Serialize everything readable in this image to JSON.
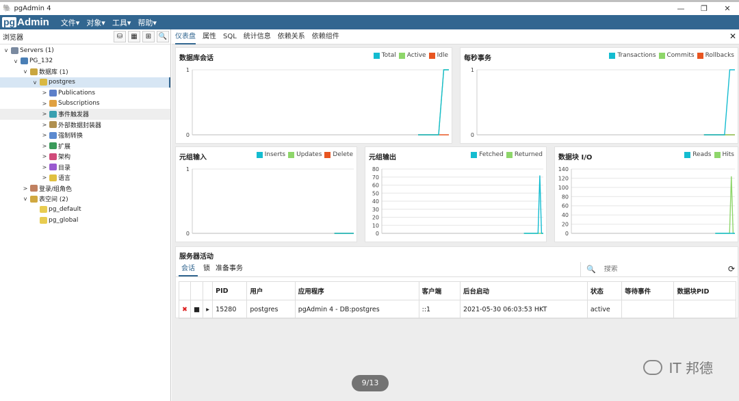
{
  "window": {
    "title": "pgAdmin 4",
    "controls": [
      "—",
      "❐",
      "✕"
    ]
  },
  "menubar": {
    "logo_pg": "pg",
    "logo_admin": "Admin",
    "items": [
      "文件▾",
      "对象▾",
      "工具▾",
      "帮助▾"
    ]
  },
  "browser": {
    "title": "浏览器",
    "tools": [
      "⛁",
      "▦",
      "⊞",
      "🔍"
    ],
    "tree": [
      {
        "label": "Servers (1)",
        "toggle": "v",
        "icon": "servers-icon",
        "color": "#7a8aa0",
        "level": 0
      },
      {
        "label": "PG_132",
        "toggle": "v",
        "icon": "elephant-icon",
        "color": "#4a7fb5",
        "level": 1
      },
      {
        "label": "数据库 (1)",
        "toggle": "v",
        "icon": "databases-icon",
        "color": "#c9a640",
        "level": 2
      },
      {
        "label": "postgres",
        "toggle": "v",
        "icon": "database-icon",
        "color": "#d9b842",
        "level": 3,
        "state": "sel"
      },
      {
        "label": "Publications",
        "toggle": ">",
        "icon": "publication-icon",
        "color": "#5c7fc9",
        "level": 4
      },
      {
        "label": "Subscriptions",
        "toggle": ">",
        "icon": "subscription-icon",
        "color": "#e0a040",
        "level": 4
      },
      {
        "label": "事件触发器",
        "toggle": ">",
        "icon": "event-trigger-icon",
        "color": "#3aa0b0",
        "level": 4,
        "state": "hov"
      },
      {
        "label": "外部数据封装器",
        "toggle": ">",
        "icon": "fdw-icon",
        "color": "#b09050",
        "level": 4
      },
      {
        "label": "强制转换",
        "toggle": ">",
        "icon": "cast-icon",
        "color": "#5c8ad0",
        "level": 4
      },
      {
        "label": "扩展",
        "toggle": ">",
        "icon": "extension-icon",
        "color": "#3a9a5a",
        "level": 4
      },
      {
        "label": "架构",
        "toggle": ">",
        "icon": "schema-icon",
        "color": "#d04a7a",
        "level": 4
      },
      {
        "label": "目录",
        "toggle": ">",
        "icon": "catalog-icon",
        "color": "#9a5ad0",
        "level": 4
      },
      {
        "label": "语言",
        "toggle": ">",
        "icon": "language-icon",
        "color": "#e0c040",
        "level": 4
      },
      {
        "label": "登录/组角色",
        "toggle": ">",
        "icon": "login-roles-icon",
        "color": "#c08060",
        "level": 2
      },
      {
        "label": "表空间 (2)",
        "toggle": "v",
        "icon": "tablespaces-icon",
        "color": "#d0a840",
        "level": 2
      },
      {
        "label": "pg_default",
        "toggle": "",
        "icon": "tablespace-icon",
        "color": "#e8cc50",
        "level": 3
      },
      {
        "label": "pg_global",
        "toggle": "",
        "icon": "tablespace-icon",
        "color": "#e8cc50",
        "level": 3
      }
    ]
  },
  "tabs": [
    "仪表盘",
    "属性",
    "SQL",
    "统计信息",
    "依赖关系",
    "依赖组件"
  ],
  "close": "✕",
  "colors": {
    "total": "#14bcd0",
    "active": "#8ed66a",
    "idle": "#e85520"
  },
  "chart_data": [
    {
      "type": "line",
      "title": "数据库会话",
      "legend": [
        "Total",
        "Active",
        "Idle"
      ],
      "yticks": [
        "1",
        "0"
      ],
      "ylim": [
        0,
        1
      ],
      "series": [
        {
          "name": "Total",
          "values": [
            0,
            0,
            0,
            0,
            0,
            1,
            1
          ]
        },
        {
          "name": "Active",
          "values": [
            0,
            0,
            0,
            0,
            0,
            1,
            1
          ]
        },
        {
          "name": "Idle",
          "values": [
            0,
            0,
            0,
            0,
            0,
            0,
            0
          ]
        }
      ]
    },
    {
      "type": "line",
      "title": "每秒事务",
      "legend": [
        "Transactions",
        "Commits",
        "Rollbacks"
      ],
      "yticks": [
        "1",
        "0"
      ],
      "ylim": [
        0,
        1
      ],
      "series": [
        {
          "name": "Transactions",
          "values": [
            0,
            0,
            0,
            0,
            0,
            1,
            1
          ]
        },
        {
          "name": "Commits",
          "values": [
            0,
            0,
            0,
            0,
            0,
            0,
            0
          ]
        },
        {
          "name": "Rollbacks",
          "values": [
            0,
            0,
            0,
            0,
            0,
            0,
            0
          ]
        }
      ]
    },
    {
      "type": "line",
      "title": "元组输入",
      "legend": [
        "Inserts",
        "Updates",
        "Delete"
      ],
      "yticks": [
        "1",
        "0"
      ],
      "ylim": [
        0,
        1
      ],
      "series": [
        {
          "name": "Inserts",
          "values": [
            0,
            0,
            0,
            0,
            0,
            0,
            0
          ]
        },
        {
          "name": "Updates",
          "values": [
            0,
            0,
            0,
            0,
            0,
            0,
            0
          ]
        },
        {
          "name": "Delete",
          "values": [
            0,
            0,
            0,
            0,
            0,
            0,
            0
          ]
        }
      ]
    },
    {
      "type": "line",
      "title": "元组输出",
      "legend": [
        "Fetched",
        "Returned"
      ],
      "yticks": [
        "80",
        "70",
        "60",
        "50",
        "40",
        "30",
        "20",
        "10",
        "0"
      ],
      "ylim": [
        0,
        80
      ],
      "series": [
        {
          "name": "Fetched",
          "values": [
            0,
            0,
            0,
            0,
            0,
            0,
            0,
            0,
            0,
            72,
            0,
            0
          ]
        },
        {
          "name": "Returned",
          "values": [
            0,
            0,
            0,
            0,
            0,
            0,
            0,
            0,
            0,
            0,
            0,
            0
          ]
        }
      ]
    },
    {
      "type": "line",
      "title": "数据块 I/O",
      "legend": [
        "Reads",
        "Hits"
      ],
      "yticks": [
        "140",
        "120",
        "100",
        "80",
        "60",
        "40",
        "20",
        "0"
      ],
      "ylim": [
        0,
        140
      ],
      "series": [
        {
          "name": "Reads",
          "values": [
            0,
            0,
            0,
            0,
            0,
            0,
            0,
            0,
            0,
            0,
            0,
            0
          ]
        },
        {
          "name": "Hits",
          "values": [
            0,
            0,
            0,
            0,
            0,
            0,
            0,
            0,
            0,
            124,
            0,
            0
          ]
        }
      ]
    }
  ],
  "activity": {
    "title": "服务器活动",
    "subtabs": [
      "会话",
      "锁",
      "准备事务"
    ],
    "search_icon": "🔍",
    "search_placeholder": "搜索",
    "refresh": "⟳",
    "columns": [
      "",
      "",
      "",
      "PID",
      "用户",
      "应用程序",
      "客户端",
      "后台启动",
      "状态",
      "等待事件",
      "数据块PID"
    ],
    "rows": [
      [
        "✖",
        "■",
        "▸",
        "15280",
        "postgres",
        "pgAdmin 4 - DB:postgres",
        "::1",
        "2021-05-30 06:03:53 HKT",
        "active",
        "",
        ""
      ]
    ]
  },
  "overlay": {
    "pager": "9/13",
    "watermark": "IT 邦德"
  }
}
